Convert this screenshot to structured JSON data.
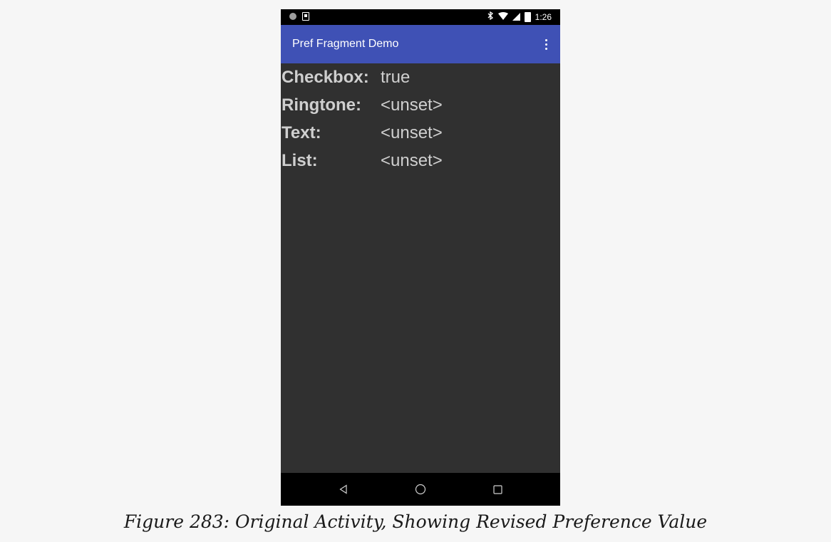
{
  "status_bar": {
    "time": "1:26",
    "icons": [
      "notification-dot-icon",
      "sim-download-icon",
      "bluetooth-icon",
      "wifi-icon",
      "cell-signal-icon",
      "battery-charging-icon"
    ]
  },
  "app_bar": {
    "title": "Pref Fragment Demo",
    "overflow_icon": "more-vert-icon",
    "color": "#3f51b5"
  },
  "preferences": [
    {
      "label": "Checkbox:",
      "value": "true"
    },
    {
      "label": "Ringtone:",
      "value": "<unset>"
    },
    {
      "label": "Text:",
      "value": "<unset>"
    },
    {
      "label": "List:",
      "value": "<unset>"
    }
  ],
  "nav_bar": {
    "buttons": [
      "back-icon",
      "home-icon",
      "recents-icon"
    ]
  },
  "caption": "Figure 283: Original Activity, Showing Revised Preference Value"
}
